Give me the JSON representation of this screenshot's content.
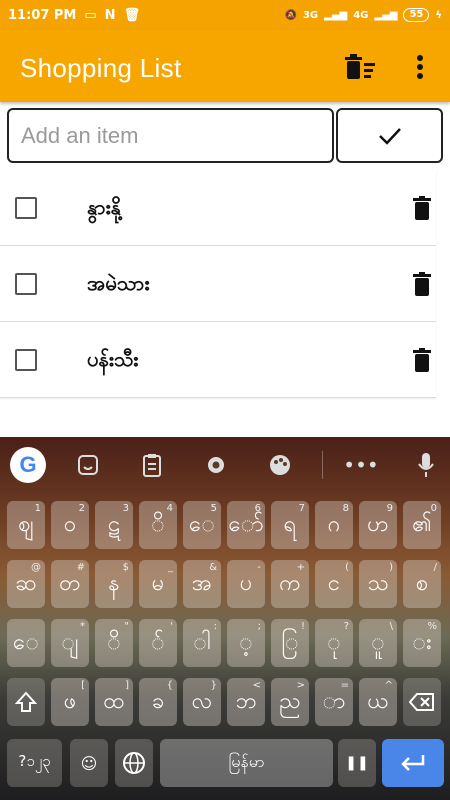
{
  "status_bar": {
    "time": "11:07 PM",
    "battery": "55",
    "signal_1": "3G",
    "signal_2": "4G"
  },
  "app_bar": {
    "title": "Shopping List"
  },
  "add_item": {
    "placeholder": "Add an item"
  },
  "items": [
    {
      "label": "နွားနို့",
      "checked": false
    },
    {
      "label": "အမဲသား",
      "checked": false
    },
    {
      "label": "ပန်းသီး",
      "checked": false
    }
  ],
  "keyboard": {
    "space_label": "မြန်မာ",
    "symbols_label": "?၁၂၃",
    "toolbar_icons": [
      "google-icon",
      "sticker-icon",
      "clipboard-icon",
      "settings-icon",
      "palette-icon",
      "more-icon",
      "microphone-icon"
    ],
    "row1": [
      {
        "key": "ဈ",
        "hint": "1"
      },
      {
        "key": "ဝ",
        "hint": "2"
      },
      {
        "key": "ဋ",
        "hint": "3"
      },
      {
        "key": "ိ",
        "hint": "4"
      },
      {
        "key": "ေ",
        "hint": "5"
      },
      {
        "key": "ော်",
        "hint": "6"
      },
      {
        "key": "ရ",
        "hint": "7"
      },
      {
        "key": "ဂ",
        "hint": "8"
      },
      {
        "key": "ဟ",
        "hint": "9"
      },
      {
        "key": "၏",
        "hint": "0"
      }
    ],
    "row2": [
      {
        "key": "ဆ",
        "hint": "@"
      },
      {
        "key": "တ",
        "hint": "#"
      },
      {
        "key": "န",
        "hint": "$"
      },
      {
        "key": "မ",
        "hint": "_"
      },
      {
        "key": "အ",
        "hint": "&"
      },
      {
        "key": "ပ",
        "hint": "-"
      },
      {
        "key": "က",
        "hint": "+"
      },
      {
        "key": "င",
        "hint": "("
      },
      {
        "key": "သ",
        "hint": ")"
      },
      {
        "key": "စ",
        "hint": "/"
      }
    ],
    "row3": [
      {
        "key": "ေ",
        "hint": ""
      },
      {
        "key": "ျ",
        "hint": "*"
      },
      {
        "key": "ိ",
        "hint": "\""
      },
      {
        "key": "်",
        "hint": "'"
      },
      {
        "key": "ါ",
        "hint": ":"
      },
      {
        "key": "့",
        "hint": ";"
      },
      {
        "key": "ြ",
        "hint": "!"
      },
      {
        "key": "ု",
        "hint": "?"
      },
      {
        "key": "ူ",
        "hint": "\\"
      },
      {
        "key": "း",
        "hint": "%"
      }
    ],
    "row4": [
      {
        "key": "ဖ",
        "hint": "["
      },
      {
        "key": "ထ",
        "hint": "]"
      },
      {
        "key": "ခ",
        "hint": "{"
      },
      {
        "key": "လ",
        "hint": "}"
      },
      {
        "key": "ဘ",
        "hint": "<"
      },
      {
        "key": "ည",
        "hint": ">"
      },
      {
        "key": "ာ",
        "hint": "="
      },
      {
        "key": "ယ",
        "hint": "^"
      }
    ]
  }
}
